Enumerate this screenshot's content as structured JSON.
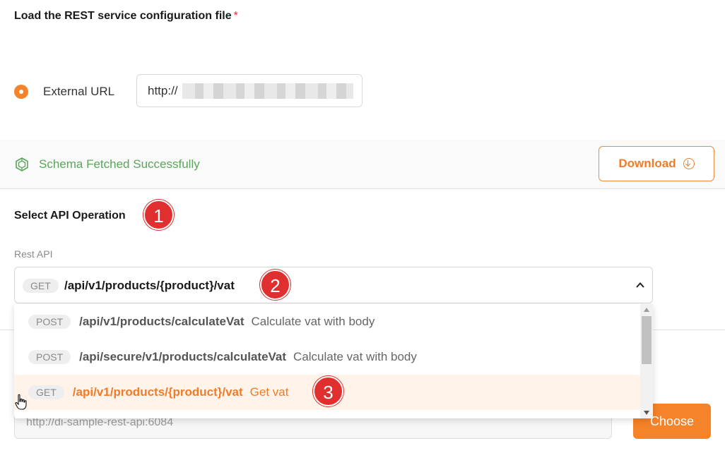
{
  "config": {
    "title": "Load the REST service configuration file",
    "required_marker": "*",
    "source_option_label": "External URL",
    "url_value": "http://"
  },
  "status": {
    "message": "Schema Fetched Successfully",
    "download_label": "Download"
  },
  "operation": {
    "title": "Select API Operation",
    "field_label": "Rest API",
    "selected": {
      "method": "GET",
      "path": "/api/v1/products/{product}/vat"
    },
    "options": [
      {
        "method": "POST",
        "path": "/api/v1/products/calculateVat",
        "desc": "Calculate vat with body"
      },
      {
        "method": "POST",
        "path": "/api/secure/v1/products/calculateVat",
        "desc": "Calculate vat with body"
      },
      {
        "method": "GET",
        "path": "/api/v1/products/{product}/vat",
        "desc": "Get vat"
      }
    ]
  },
  "annotations": [
    "1",
    "2",
    "3"
  ],
  "base_url": {
    "value": "http://di-sample-rest-api:6084"
  },
  "choose_label": "Choose",
  "colors": {
    "accent": "#f5832a",
    "success": "#5aa55a",
    "annotation": "#e02f2f"
  }
}
